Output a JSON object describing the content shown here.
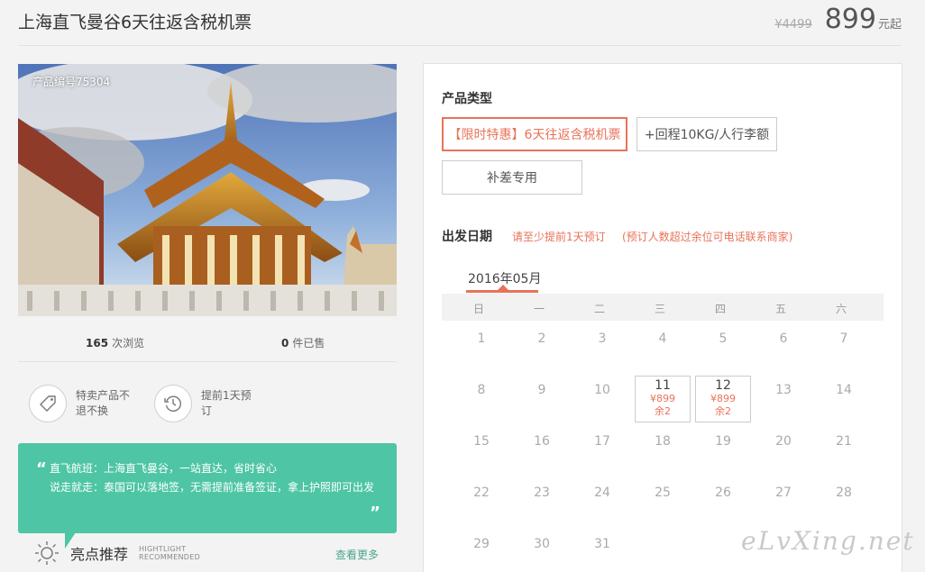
{
  "header": {
    "title": "上海直飞曼谷6天往返含税机票",
    "old_price": "¥4499",
    "price": "899",
    "price_unit": "元起"
  },
  "gallery": {
    "product_no": "产品编号75304"
  },
  "stats": {
    "views_count": "165",
    "views_label": "次浏览",
    "sold_count": "0",
    "sold_label": "件已售"
  },
  "features": [
    {
      "icon": "tag-icon",
      "text": "特卖产品不退不换"
    },
    {
      "icon": "clock-history-icon",
      "text": "提前1天预订"
    }
  ],
  "highlight": {
    "line1": "直飞航班：上海直飞曼谷，一站直达，省时省心",
    "line2": "说走就走：泰国可以落地签，无需提前准备签证，拿上护照即可出发",
    "title": "亮点推荐",
    "en1": "HIGHTLIGHT",
    "en2": "RECOMMENDED",
    "more": "查看更多"
  },
  "booking": {
    "type_label": "产品类型",
    "options": [
      "【限时特惠】6天往返含税机票",
      "+回程10KG/人行李额",
      "补差专用"
    ],
    "date_label": "出发日期",
    "note1": "请至少提前1天预订",
    "note2": "(预订人数超过余位可电话联系商家)",
    "month": "2016年05月",
    "weekdays": [
      "日",
      "一",
      "二",
      "三",
      "四",
      "五",
      "六"
    ],
    "days": [
      "1",
      "2",
      "3",
      "4",
      "5",
      "6",
      "7",
      "8",
      "9",
      "10",
      "11",
      "12",
      "13",
      "14",
      "15",
      "16",
      "17",
      "18",
      "19",
      "20",
      "21",
      "22",
      "23",
      "24",
      "25",
      "26",
      "27",
      "28",
      "29",
      "30",
      "31"
    ],
    "available": {
      "11": {
        "price": "¥899",
        "left": "余2"
      },
      "12": {
        "price": "¥899",
        "left": "余2"
      }
    }
  },
  "watermark": "eLvXing.net",
  "colors": {
    "accent": "#e8735a",
    "green": "#4ec5a5"
  }
}
